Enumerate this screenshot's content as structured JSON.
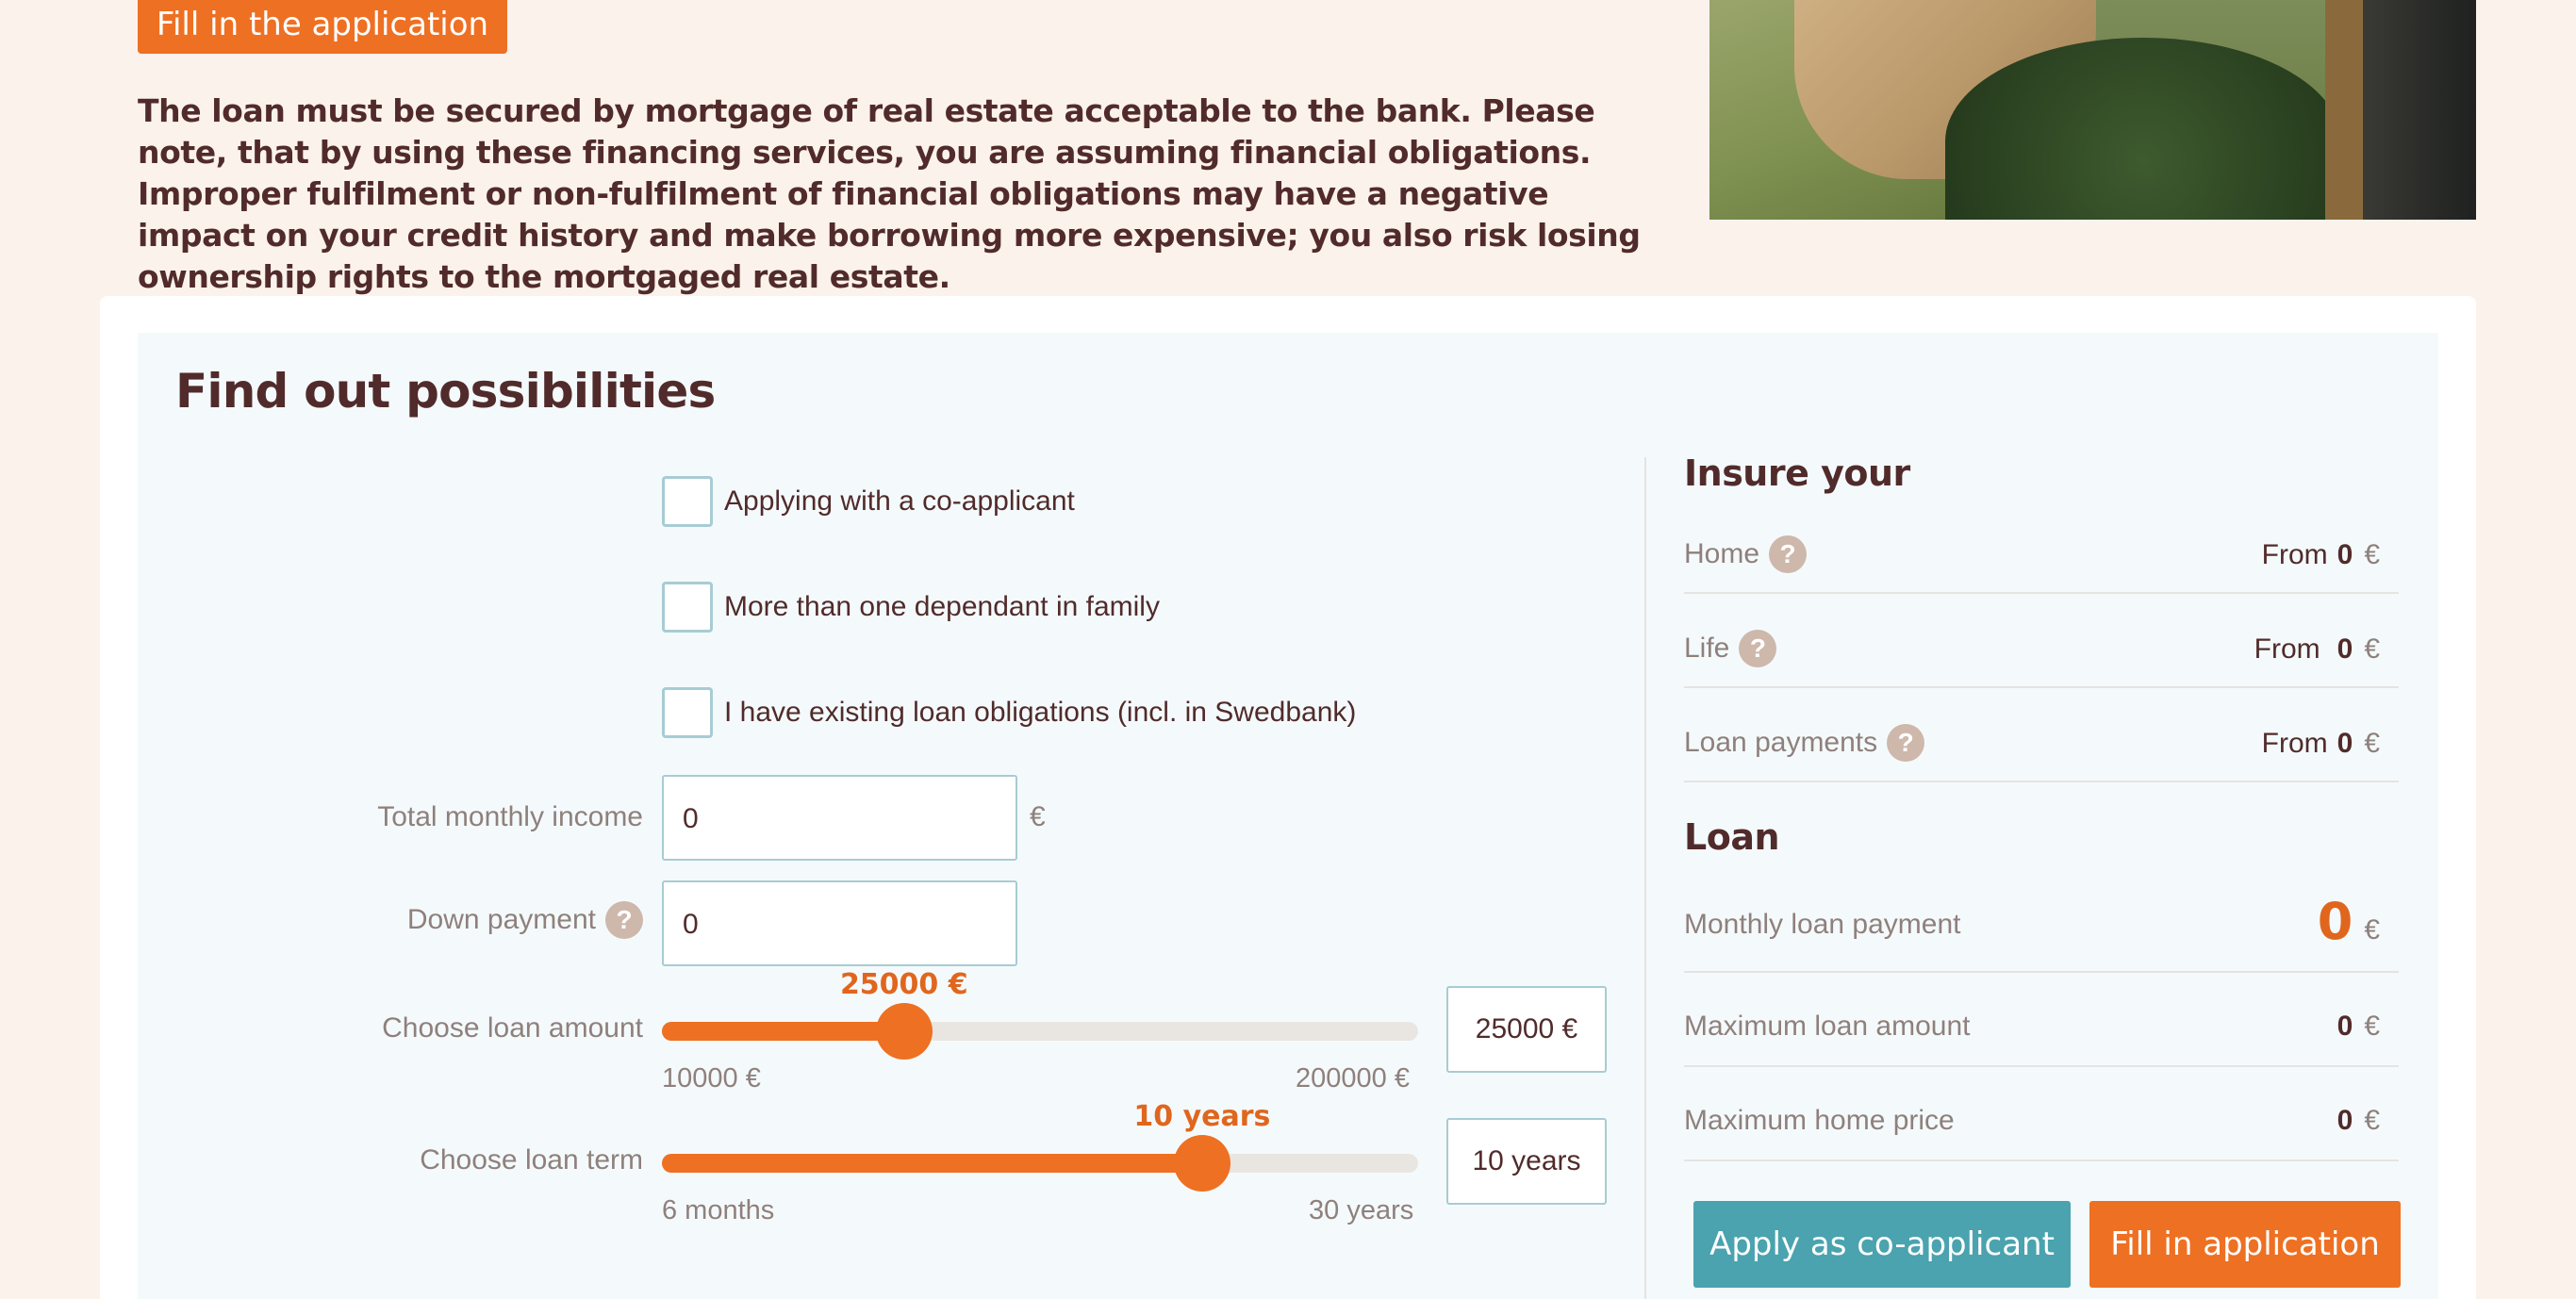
{
  "hero": {
    "button_label": "Fill in the application",
    "disclaimer": "The loan must be secured by mortgage of real estate acceptable to the bank. Please note, that by using these financing services, you are assuming financial obligations. Improper fulfilment or non-fulfilment of financial obligations may have a negative impact on your credit history and make borrowing more expensive; you also risk losing ownership rights to the mortgaged real estate."
  },
  "calculator": {
    "title": "Find out possibilities",
    "checkboxes": [
      {
        "label": "Applying with a co-applicant",
        "checked": false
      },
      {
        "label": "More than one dependant in family",
        "checked": false
      },
      {
        "label": "I have existing loan obligations (incl. in Swedbank)",
        "checked": false
      }
    ],
    "income": {
      "label": "Total monthly income",
      "value": "0",
      "unit": "€"
    },
    "down_payment": {
      "label": "Down payment",
      "value": "0",
      "help": "?"
    },
    "loan_amount": {
      "label": "Choose loan amount",
      "value_label": "25000 €",
      "min_label": "10000 €",
      "max_label": "200000 €",
      "box_value": "25000 €",
      "min": 10000,
      "max": 200000,
      "value": 25000
    },
    "loan_term": {
      "label": "Choose loan term",
      "value_label": "10 years",
      "min_label": "6 months",
      "max_label": "30 years",
      "box_value": "10 years",
      "min": 0.5,
      "max": 30,
      "value": 10
    }
  },
  "insure": {
    "heading": "Insure your",
    "rows": [
      {
        "label": "Home",
        "prefix": "From",
        "value": "0",
        "unit": "€"
      },
      {
        "label": "Life",
        "prefix": "From",
        "value": "0",
        "unit": "€"
      },
      {
        "label": "Loan payments",
        "prefix": "From",
        "value": "0",
        "unit": "€"
      }
    ],
    "help": "?"
  },
  "loan": {
    "heading": "Loan",
    "monthly": {
      "label": "Monthly loan payment",
      "value": "0",
      "unit": "€"
    },
    "max_amount": {
      "label": "Maximum loan amount",
      "value": "0",
      "unit": "€"
    },
    "max_price": {
      "label": "Maximum home price",
      "value": "0",
      "unit": "€"
    }
  },
  "actions": {
    "co_applicant": "Apply as co-applicant",
    "fill": "Fill in application"
  },
  "colors": {
    "accent": "#ee7023",
    "teal": "#4aa3ae",
    "text": "#512b2b",
    "muted": "#8f807c"
  }
}
